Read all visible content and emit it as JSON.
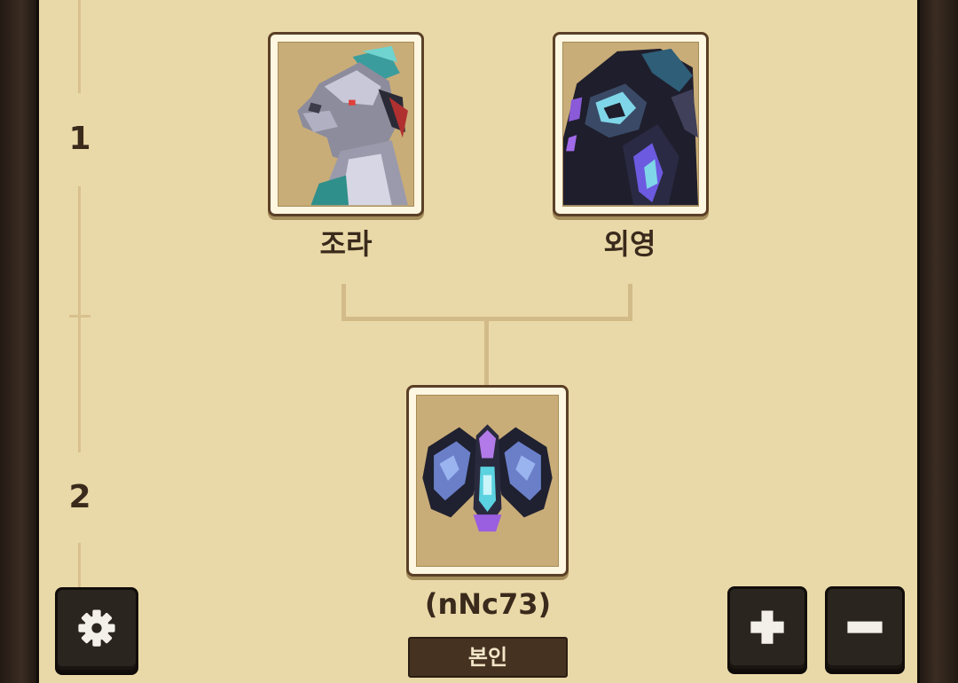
{
  "generations": [
    {
      "number": "1"
    },
    {
      "number": "2"
    }
  ],
  "parents": [
    {
      "name": "조라",
      "portrait": "white-dragon-portrait"
    },
    {
      "name": "외영",
      "portrait": "shadow-dragon-portrait"
    }
  ],
  "child": {
    "name": "(nNc73)",
    "portrait": "dark-winged-dragon-portrait",
    "badge": "본인"
  },
  "controls": {
    "settings_icon": "gear-icon",
    "zoom_in_icon": "plus-icon",
    "zoom_out_icon": "minus-icon"
  },
  "colors": {
    "parchment": "#ead9a8",
    "frame": "#2c221b",
    "connector": "#d2bb88",
    "text": "#3a2a1c"
  }
}
